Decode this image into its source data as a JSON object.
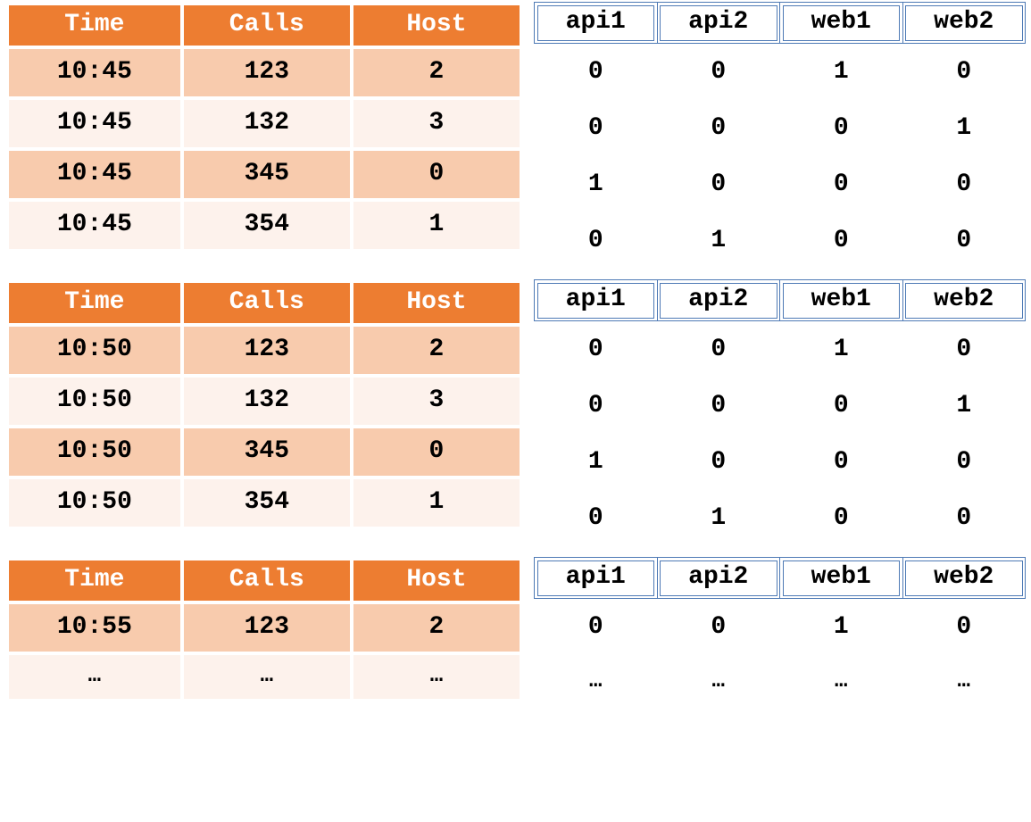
{
  "blocks": [
    {
      "left": {
        "headers": [
          "Time",
          "Calls",
          "Host"
        ],
        "rows": [
          [
            "10:45",
            "123",
            "2"
          ],
          [
            "10:45",
            "132",
            "3"
          ],
          [
            "10:45",
            "345",
            "0"
          ],
          [
            "10:45",
            "354",
            "1"
          ]
        ]
      },
      "right": {
        "headers": [
          "api1",
          "api2",
          "web1",
          "web2"
        ],
        "rows": [
          [
            "0",
            "0",
            "1",
            "0"
          ],
          [
            "0",
            "0",
            "0",
            "1"
          ],
          [
            "1",
            "0",
            "0",
            "0"
          ],
          [
            "0",
            "1",
            "0",
            "0"
          ]
        ]
      }
    },
    {
      "left": {
        "headers": [
          "Time",
          "Calls",
          "Host"
        ],
        "rows": [
          [
            "10:50",
            "123",
            "2"
          ],
          [
            "10:50",
            "132",
            "3"
          ],
          [
            "10:50",
            "345",
            "0"
          ],
          [
            "10:50",
            "354",
            "1"
          ]
        ]
      },
      "right": {
        "headers": [
          "api1",
          "api2",
          "web1",
          "web2"
        ],
        "rows": [
          [
            "0",
            "0",
            "1",
            "0"
          ],
          [
            "0",
            "0",
            "0",
            "1"
          ],
          [
            "1",
            "0",
            "0",
            "0"
          ],
          [
            "0",
            "1",
            "0",
            "0"
          ]
        ]
      }
    },
    {
      "left": {
        "headers": [
          "Time",
          "Calls",
          "Host"
        ],
        "rows": [
          [
            "10:55",
            "123",
            "2"
          ],
          [
            "…",
            "…",
            "…"
          ]
        ]
      },
      "right": {
        "headers": [
          "api1",
          "api2",
          "web1",
          "web2"
        ],
        "rows": [
          [
            "0",
            "0",
            "1",
            "0"
          ],
          [
            "…",
            "…",
            "…",
            "…"
          ]
        ]
      }
    }
  ]
}
